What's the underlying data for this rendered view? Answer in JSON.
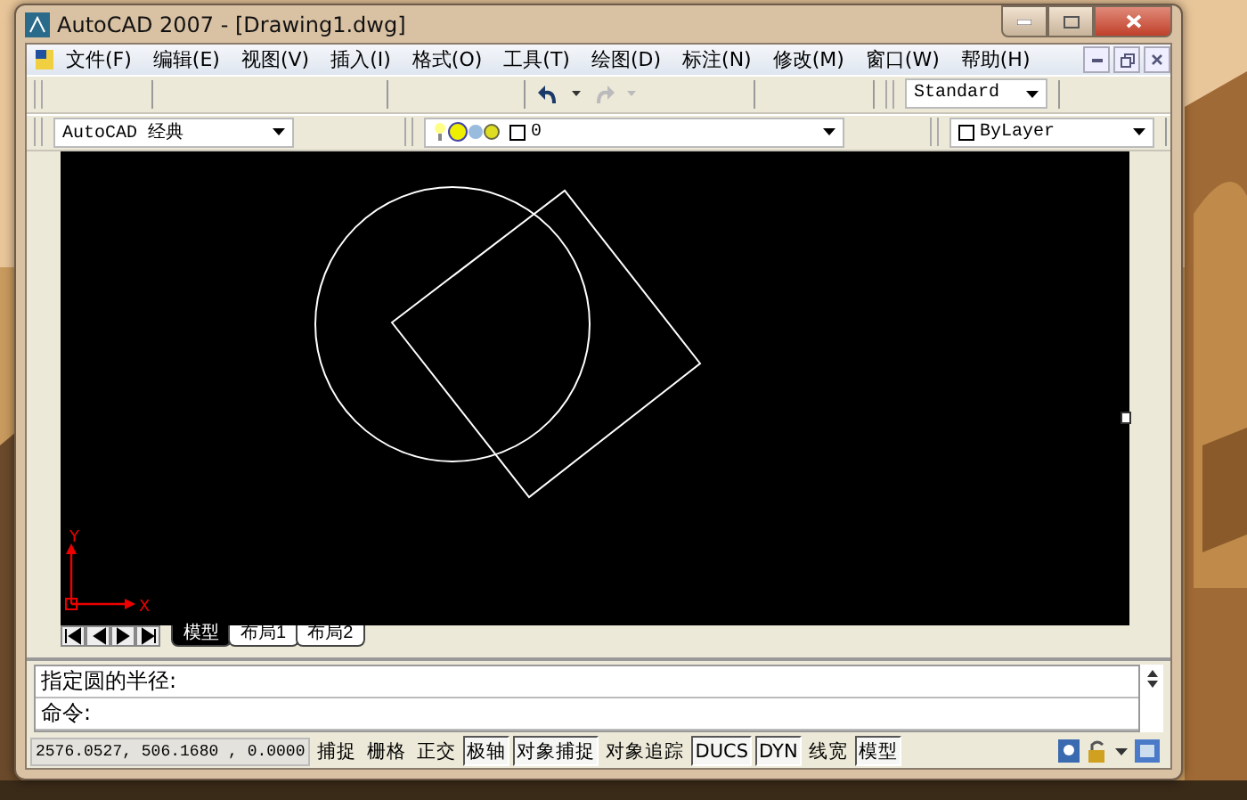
{
  "window": {
    "title": "AutoCAD 2007 - [Drawing1.dwg]"
  },
  "menu": [
    "文件(F)",
    "编辑(E)",
    "视图(V)",
    "插入(I)",
    "格式(O)",
    "工具(T)",
    "绘图(D)",
    "标注(N)",
    "修改(M)",
    "窗口(W)",
    "帮助(H)"
  ],
  "toolbar": {
    "text_style": "Standard",
    "workspace": "AutoCAD 经典",
    "layer": "0",
    "color_setting": "ByLayer"
  },
  "layout_tabs": [
    {
      "label": "模型",
      "selected": true
    },
    {
      "label": "布局1",
      "selected": false
    },
    {
      "label": "布局2",
      "selected": false
    }
  ],
  "ucs": {
    "y_label": "Y",
    "x_label": "X"
  },
  "command_lines": [
    "指定圆的半径:",
    "命令:"
  ],
  "status_bar": {
    "coordinates": "2576.0527,  506.1680 ,  0.0000",
    "toggles": [
      {
        "label": "捕捉",
        "on": false
      },
      {
        "label": "栅格",
        "on": false
      },
      {
        "label": "正交",
        "on": false
      },
      {
        "label": "极轴",
        "on": true
      },
      {
        "label": "对象捕捉",
        "on": true
      },
      {
        "label": "对象追踪",
        "on": false
      },
      {
        "label": "DUCS",
        "on": true
      },
      {
        "label": "DYN",
        "on": true
      },
      {
        "label": "线宽",
        "on": false
      },
      {
        "label": "模型",
        "on": true
      }
    ]
  }
}
